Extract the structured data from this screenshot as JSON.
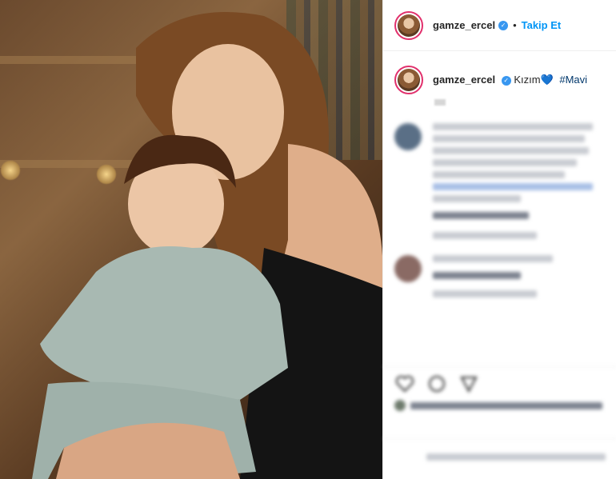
{
  "post": {
    "username": "gamze_ercel",
    "follow_label": "Takip Et",
    "separator": "•",
    "caption_text": "Kızım",
    "caption_emoji": "💙",
    "hashtag": "#Mavi"
  },
  "icons": {
    "verified": "✓",
    "like": "heart-icon",
    "comment": "comment-icon",
    "share": "share-icon"
  },
  "colors": {
    "follow": "#0095f6",
    "verified_badge": "#3897f0",
    "story_ring": "#e1306c"
  }
}
